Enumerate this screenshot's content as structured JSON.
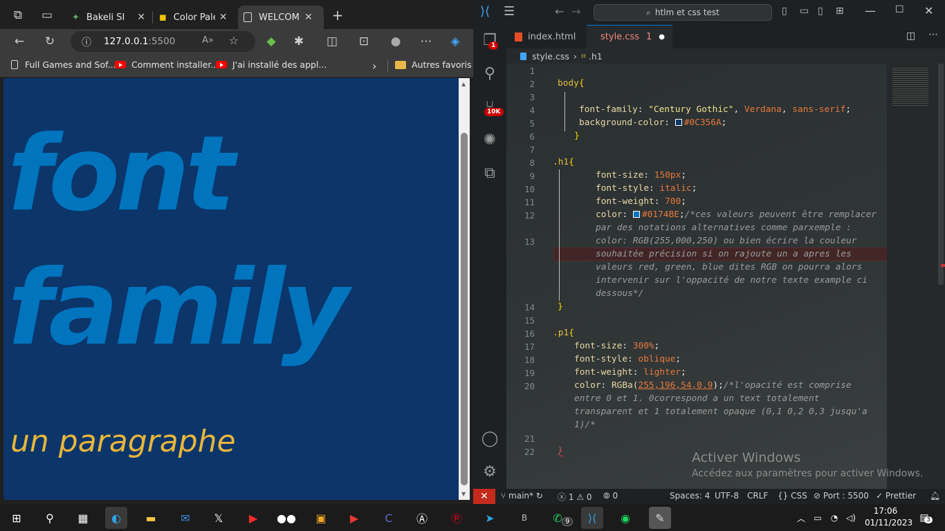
{
  "browser": {
    "tabs": [
      {
        "label": "Bakeli SI"
      },
      {
        "label": "Color Palette"
      },
      {
        "label": "WELCOME"
      }
    ],
    "new_tab_symbol": "+",
    "address_host": "127.0.0.1",
    "address_port": ":5500",
    "bookmarks": [
      {
        "label": "Full Games and Sof..."
      },
      {
        "label": "Comment installer..."
      },
      {
        "label": "J'ai installé des appl..."
      }
    ],
    "other_favorites": "Autres favoris",
    "page": {
      "h1_text": "font family",
      "p1_text": "un paragraphe",
      "background": "#0C356A",
      "h1_color": "#0174BE"
    }
  },
  "vscode": {
    "search_text": "htlm et css test",
    "tabs": [
      {
        "label": "index.html"
      },
      {
        "label": "style.css",
        "problems": "1"
      }
    ],
    "breadcrumb": {
      "file": "style.css",
      "symbol": ".h1"
    },
    "activity_badges": {
      "explorer": "1",
      "scm": "10K"
    },
    "code": {
      "lines": [
        "1",
        "2",
        "3",
        "4",
        "5",
        "6",
        "7",
        "8",
        "9",
        "10",
        "11",
        "12",
        "13",
        "14",
        "15",
        "16",
        "17",
        "18",
        "19",
        "20",
        "21",
        "22"
      ],
      "body_sel": "body",
      "ff_prop": "font-family",
      "ff_val1": "\"Century Gothic\"",
      "ff_val2": "Verdana",
      "ff_val3": "sans-serif",
      "bg_prop": "background-color",
      "bg_val": "#0C356A",
      "h1_sel": ".h1",
      "fs_prop": "font-size",
      "fs_val": "150px",
      "fst_prop": "font-style",
      "fst_val": "italic",
      "fw_prop": "font-weight",
      "fw_val": "700",
      "col_prop": "color",
      "col_val": "#0174BE",
      "cmt1": [
        "/*ces valeurs peuvent être remplacer",
        "par des notations alternatives comme parxemple :",
        "color: RGB(255,000,250) ou bien écrire la couleur",
        "souhaitée précision si on rajoute un a apres les",
        "valeurs red, green, blue dites RGB on pourra alors",
        "intervenir sur l'oppacité de notre texte example ci",
        "dessous*/"
      ],
      "p1_sel": ".p1",
      "p_fs_val": "300%",
      "p_fst_val": "oblique",
      "p_fw_val": "lighter",
      "p_col_fn": "RGBa(",
      "p_col_args": "255,196,54,0.9",
      "p_col_close": ");",
      "cmt2": [
        "/*l'opacité est comprise",
        "entre 0 et 1. 0correspond a un text totalement",
        "transparent et 1 totalement opaque (0,1 0,2 0,3 jusqu'a",
        "1)/*"
      ],
      "open_brace": "{",
      "close_brace": "}",
      "colon": ":",
      "semicolon": ";",
      "comma": ","
    },
    "watermark_title": "Activer Windows",
    "watermark_sub": "Accédez aux paramètres pour activer Windows.",
    "status": {
      "branch": "main*",
      "errors": "1",
      "warnings": "0",
      "ports": "0",
      "spaces": "Spaces: 4",
      "encoding": "UTF-8",
      "eol": "CRLF",
      "language": "CSS",
      "port": "Port : 5500",
      "prettier": "Prettier"
    }
  },
  "taskbar": {
    "time": "17:06",
    "date": "01/11/2023",
    "whatsapp_badge": "9",
    "notif_count": "3"
  }
}
